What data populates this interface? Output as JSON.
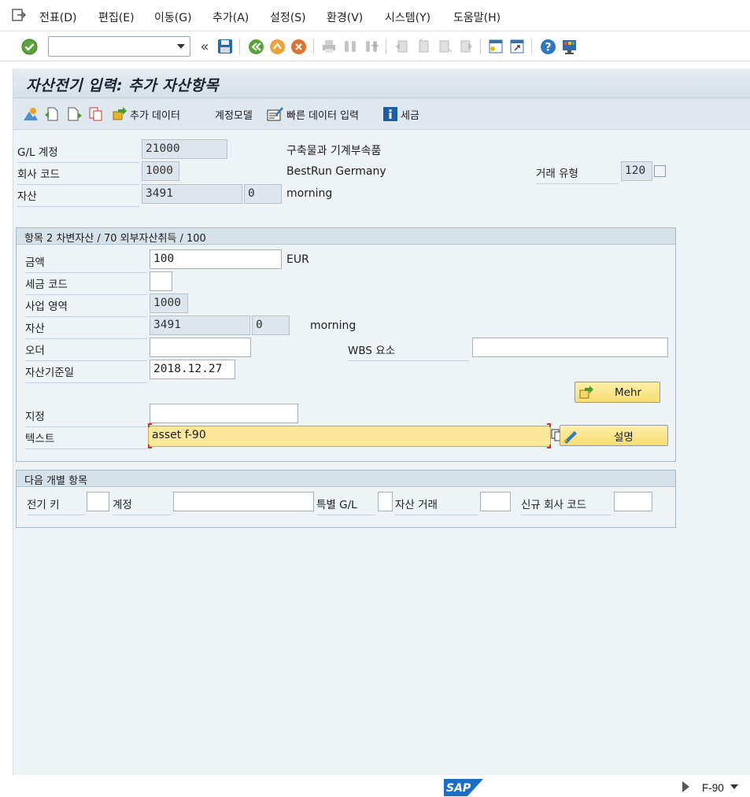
{
  "menu": {
    "items": [
      "전표(D)",
      "편집(E)",
      "이동(G)",
      "추가(A)",
      "설정(S)",
      "환경(V)",
      "시스템(Y)",
      "도움말(H)"
    ]
  },
  "toolbar": {
    "command_value": ""
  },
  "title": "자산전기 입력: 추가 자산항목",
  "app_toolbar": {
    "add_data": "추가 데이터",
    "account_model": "계정모델",
    "fast_entry": "빠른 데이터 입력",
    "tax": "세금"
  },
  "header": {
    "gl_account_label": "G/L 계정",
    "gl_account_value": "21000",
    "gl_account_desc": "구축물과 기계부속품",
    "company_label": "회사 코드",
    "company_value": "1000",
    "company_desc": "BestRun Germany",
    "trans_type_label": "거래 유형",
    "trans_type_value": "120",
    "asset_label": "자산",
    "asset_value": "3491",
    "asset_sub": "0",
    "asset_desc": "morning"
  },
  "item": {
    "group_title": "항목 2 차변자산 / 70 외부자산취득 / 100",
    "amount_label": "금액",
    "amount_value": "100",
    "currency": "EUR",
    "tax_code_label": "세금 코드",
    "tax_code_value": "",
    "business_area_label": "사업 영역",
    "business_area_value": "1000",
    "asset_label": "자산",
    "asset_value": "3491",
    "asset_sub": "0",
    "asset_desc": "morning",
    "order_label": "오더",
    "order_value": "",
    "wbs_label": "WBS 요소",
    "wbs_value": "",
    "asset_date_label": "자산기준일",
    "asset_date_value": "2018.12.27",
    "more_button": "Mehr",
    "assignment_label": "지정",
    "assignment_value": "",
    "text_label": "텍스트",
    "text_value": "asset f-90",
    "description_button": "설명"
  },
  "next_item": {
    "group_title": "다음 개별 항목",
    "posting_key_label": "전기 키",
    "posting_key_value": "",
    "account_label": "계정",
    "account_value": "",
    "special_gl_label": "특별 G/L",
    "special_gl_value": "",
    "asset_trans_label": "자산 거래",
    "asset_trans_value": "",
    "new_company_label": "신규 회사 코드",
    "new_company_value": ""
  },
  "status": {
    "logo": "SAP",
    "transaction": "F-90"
  }
}
